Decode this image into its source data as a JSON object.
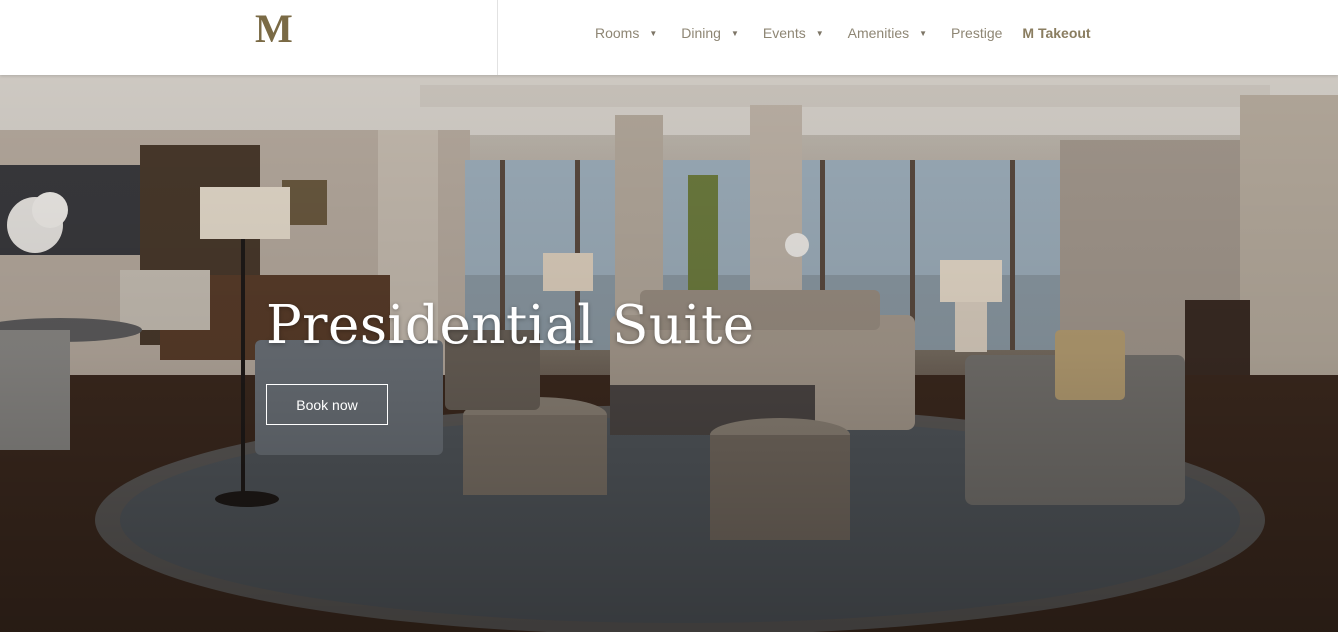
{
  "header": {
    "logo": "M",
    "nav": [
      {
        "label": "Rooms",
        "dropdown": true
      },
      {
        "label": "Dining",
        "dropdown": true
      },
      {
        "label": "Events",
        "dropdown": true
      },
      {
        "label": "Amenities",
        "dropdown": true
      },
      {
        "label": "Prestige",
        "dropdown": false
      },
      {
        "label": "M Takeout",
        "dropdown": false
      }
    ],
    "caret": "▼"
  },
  "hero": {
    "title": "Presidential Suite",
    "button_label": "Book now"
  },
  "colors": {
    "brand": "#7a6a45",
    "nav_text": "#8e8674",
    "header_bg": "#ffffff"
  }
}
